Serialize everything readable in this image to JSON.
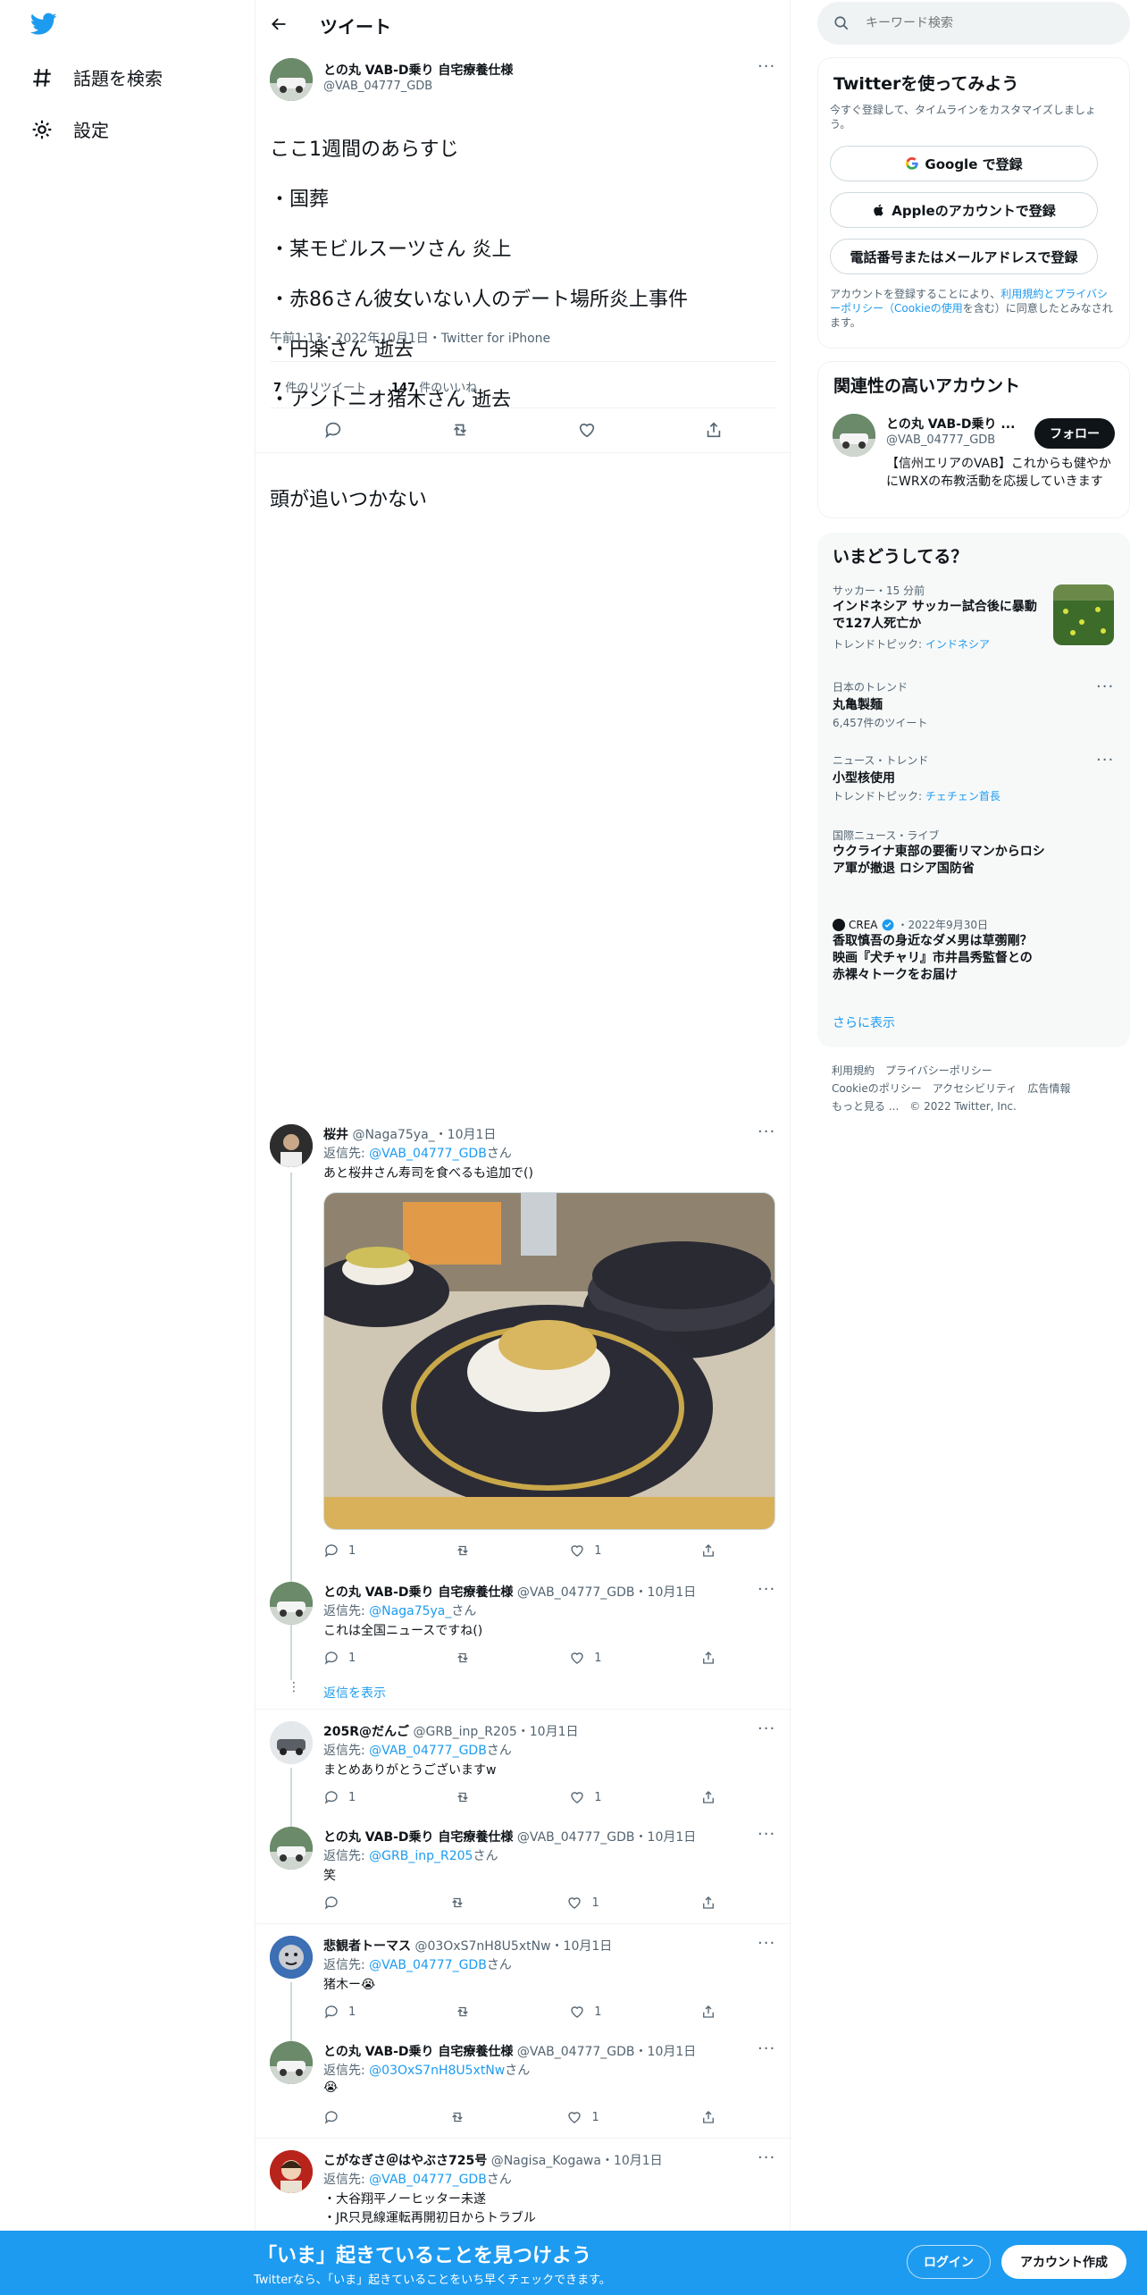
{
  "nav": {
    "explore": "話題を検索",
    "settings": "設定"
  },
  "header": {
    "title": "ツイート"
  },
  "main_tweet": {
    "name": "との丸 VAB-D乗り 自宅療養仕様",
    "handle": "@VAB_04777_GDB",
    "lines": [
      "ここ1週間のあらすじ",
      "・国葬",
      "・某モビルスーツさん 炎上",
      "・赤86さん彼女いない人のデート場所炎上事件",
      "・円楽さん 逝去",
      "・アントニオ猪木さん 逝去",
      "",
      "頭が追いつかない"
    ],
    "meta": "午前1:13・2022年10月1日・Twitter for iPhone",
    "retweet_count": "7",
    "retweet_label": "件のリツイート",
    "like_count": "147",
    "like_label": "件のいいね"
  },
  "replies": [
    {
      "name": "桜井",
      "handle": "@Naga75ya_",
      "date": "・10月1日",
      "reply_prefix": "返信先: ",
      "reply_to": "@VAB_04777_GDB",
      "reply_suffix": "さん",
      "text": "あと桜井さん寿司を食べるも追加で()",
      "replies": "1",
      "likes": "1"
    },
    {
      "name": "との丸 VAB-D乗り 自宅療養仕様",
      "handle": "@VAB_04777_GDB",
      "date": "・10月1日",
      "reply_prefix": "返信先: ",
      "reply_to": "@Naga75ya_",
      "reply_suffix": "さん",
      "text": "これは全国ニュースですね()",
      "replies": "1",
      "likes": "1"
    },
    {
      "name": "205R@だんご",
      "handle": "@GRB_inp_R205",
      "date": "・10月1日",
      "reply_prefix": "返信先: ",
      "reply_to": "@VAB_04777_GDB",
      "reply_suffix": "さん",
      "text": "まとめありがとうございますw",
      "replies": "1",
      "likes": "1"
    },
    {
      "name": "との丸 VAB-D乗り 自宅療養仕様",
      "handle": "@VAB_04777_GDB",
      "date": "・10月1日",
      "reply_prefix": "返信先: ",
      "reply_to": "@GRB_inp_R205",
      "reply_suffix": "さん",
      "text": "笑",
      "replies": "",
      "likes": "1"
    },
    {
      "name": "悲観者トーマス",
      "handle": "@03OxS7nH8U5xtNw",
      "date": "・10月1日",
      "reply_prefix": "返信先: ",
      "reply_to": "@VAB_04777_GDB",
      "reply_suffix": "さん",
      "text": "猪木ー😭",
      "replies": "1",
      "likes": "1"
    },
    {
      "name": "との丸 VAB-D乗り 自宅療養仕様",
      "handle": "@VAB_04777_GDB",
      "date": "・10月1日",
      "reply_prefix": "返信先: ",
      "reply_to": "@03OxS7nH8U5xtNw",
      "reply_suffix": "さん",
      "text": "😭",
      "replies": "",
      "likes": "1"
    },
    {
      "name": "こがなぎさ＠はやぶさ725号",
      "handle": "@Nagisa_Kogawa",
      "date": "・10月1日",
      "reply_prefix": "返信先: ",
      "reply_to": "@VAB_04777_GDB",
      "reply_suffix": "さん",
      "text": "・大谷翔平ノーヒッター未遂",
      "text2": "・JR只見線運転再開初日からトラブル",
      "replies": "",
      "likes": ""
    }
  ],
  "show_replies": "返信を表示",
  "search": {
    "placeholder": "キーワード検索"
  },
  "signup": {
    "title": "Twitterを使ってみよう",
    "subtitle": "今すぐ登録して、タイムラインをカスタマイズしましょう。",
    "google": "Google で登録",
    "apple": "Appleのアカウントで登録",
    "phone": "電話番号またはメールアドレスで登録",
    "terms_pre": "アカウントを登録することにより、",
    "terms_link": "利用規約とプライバシーポリシー（Cookieの使用",
    "terms_post": "を含む）に同意したとみなされます。"
  },
  "related": {
    "title": "関連性の高いアカウント",
    "name": "との丸 VAB-D乗り ...",
    "handle": "@VAB_04777_GDB",
    "follow": "フォロー",
    "bio": "【信州エリアのVAB】これからも健やかにWRXの布教活動を応援していきます"
  },
  "trends": {
    "title": "いまどうしてる？",
    "items": [
      {
        "meta": "サッカー・15 分前",
        "title": "インドネシア サッカー試合後に暴動で127人死亡か",
        "sub_pre": "トレンドトピック: ",
        "sub_link": "インドネシア"
      },
      {
        "meta": "日本のトレンド",
        "title": "丸亀製麺",
        "sub_pre": "6,457件のツイート",
        "sub_link": ""
      },
      {
        "meta": "ニュース・トレンド",
        "title": "小型核使用",
        "sub_pre": "トレンドトピック: ",
        "sub_link": "チェチェン首長"
      },
      {
        "meta": "国際ニュース・ライブ",
        "title": "ウクライナ東部の要衝リマンからロシア軍が撤退 ロシア国防省",
        "sub_pre": "",
        "sub_link": ""
      },
      {
        "meta": "CREA",
        "meta2": "・2022年9月30日",
        "title": "香取慎吾の身近なダメ男は草彅剛？ 映画『犬チャリ』市井昌秀監督との 赤裸々トークをお届け",
        "sub_pre": "",
        "sub_link": ""
      }
    ],
    "more": "さらに表示"
  },
  "footer": {
    "line1": "利用規約　プライバシーポリシー",
    "line2": "Cookieのポリシー　アクセシビリティ　広告情報",
    "line3": "もっと見る ...　© 2022 Twitter, Inc."
  },
  "banner": {
    "title": "「いま」起きていることを見つけよう",
    "subtitle": "Twitterなら、「いま」起きていることをいち早くチェックできます。",
    "login": "ログイン",
    "signup": "アカウント作成"
  },
  "colors": {
    "accent": "#1d9bf0",
    "text": "#0f1419",
    "muted": "#536471"
  }
}
